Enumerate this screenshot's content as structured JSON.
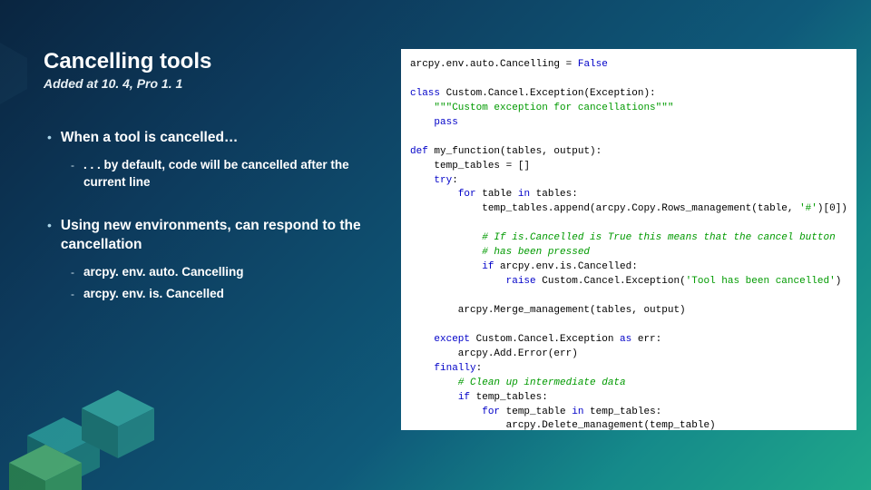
{
  "header": {
    "title": "Cancelling tools",
    "subtitle": "Added at 10. 4, Pro 1. 1"
  },
  "bullets": {
    "b1": "When a tool is cancelled…",
    "b1a": ". . . by default, code will be cancelled after the current line",
    "b2": "Using new environments, can respond to the cancellation",
    "b2a": "arcpy. env. auto. Cancelling",
    "b2b": "arcpy. env. is. Cancelled"
  },
  "code": {
    "l01a": "arcpy.env.auto.Cancelling = ",
    "l01b": "False",
    "l03a": "class",
    "l03b": " Custom.Cancel.Exception(Exception):",
    "l04": "    \"\"\"Custom exception for cancellations\"\"\"",
    "l05a": "    ",
    "l05b": "pass",
    "l07a": "def",
    "l07b": " my_function(tables, output):",
    "l08": "    temp_tables = []",
    "l09a": "    ",
    "l09b": "try",
    "l09c": ":",
    "l10a": "        ",
    "l10b": "for",
    "l10c": " table ",
    "l10d": "in",
    "l10e": " tables:",
    "l11a": "            temp_tables.append(arcpy.Copy.Rows_management(table, ",
    "l11b": "'#'",
    "l11c": ")[",
    "l11d": "0",
    "l11e": "])",
    "l13": "            # If is.Cancelled is True this means that the cancel button",
    "l14": "            # has been pressed",
    "l15a": "            ",
    "l15b": "if",
    "l15c": " arcpy.env.is.Cancelled:",
    "l16a": "                ",
    "l16b": "raise",
    "l16c": " Custom.Cancel.Exception(",
    "l16d": "'Tool has been cancelled'",
    "l16e": ")",
    "l18": "        arcpy.Merge_management(tables, output)",
    "l20a": "    ",
    "l20b": "except",
    "l20c": " Custom.Cancel.Exception ",
    "l20d": "as",
    "l20e": " err:",
    "l21": "        arcpy.Add.Error(err)",
    "l22a": "    ",
    "l22b": "finally",
    "l22c": ":",
    "l23": "        # Clean up intermediate data",
    "l24a": "        ",
    "l24b": "if",
    "l24c": " temp_tables:",
    "l25a": "            ",
    "l25b": "for",
    "l25c": " temp_table ",
    "l25d": "in",
    "l25e": " temp_tables:",
    "l26": "                arcpy.Delete_management(temp_table)"
  }
}
